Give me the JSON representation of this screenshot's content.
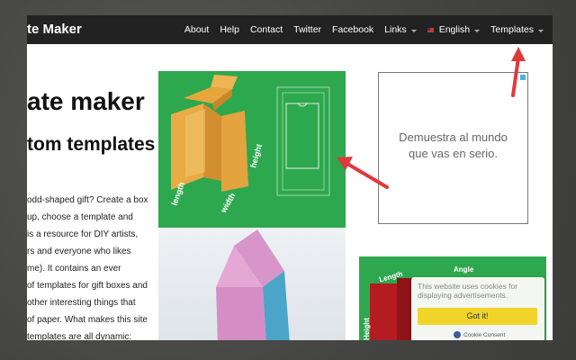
{
  "brand": "te Maker",
  "nav": {
    "about": "About",
    "help": "Help",
    "contact": "Contact",
    "twitter": "Twitter",
    "facebook": "Facebook",
    "links": "Links",
    "english": "English",
    "templates": "Templates"
  },
  "hero": {
    "title": "ate maker",
    "subtitle": "tom templates"
  },
  "intro_lines": [
    "odd-shaped gift? Create a box",
    "up, choose a template and",
    "is a resource for DIY artists,",
    "rs and everyone who likes",
    "me). It contains an ever",
    "of templates for gift boxes and",
    "other interesting things that",
    "of paper. What makes this site",
    "templates are all dynamic:"
  ],
  "image1_labels": {
    "height": "height",
    "length": "length",
    "width": "width"
  },
  "ad1": {
    "line1": "Demuestra al mundo",
    "line2": "que vas en serio."
  },
  "ad2_labels": {
    "length": "Length",
    "angle": "Angle",
    "height": "Height"
  },
  "cookie": {
    "text": "This website uses cookies for displaying advertisements.",
    "button": "Got it!",
    "brand": "Cookie Consent"
  },
  "colors": {
    "navbar": "#222222",
    "green": "#2ea84e",
    "arrow": "#e0393b",
    "cookie_button": "#f0d42a"
  }
}
